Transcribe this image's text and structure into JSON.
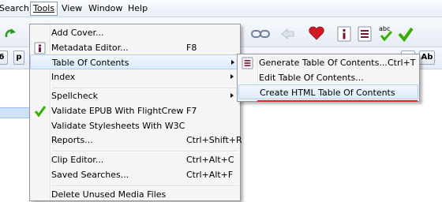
{
  "menubar": {
    "items": [
      {
        "label": "Search"
      },
      {
        "label": "Tools"
      },
      {
        "label": "View"
      },
      {
        "label": "Window"
      },
      {
        "label": "Help"
      }
    ]
  },
  "toolbar2": {
    "btn_6": "6",
    "btn_p": "p",
    "btn_ab": "Ab"
  },
  "tools_menu": {
    "items": [
      {
        "label": "Add Cover...",
        "shortcut": ""
      },
      {
        "label": "Metadata Editor...",
        "shortcut": "F8"
      },
      {
        "label": "Table Of Contents",
        "shortcut": ""
      },
      {
        "label": "Index",
        "shortcut": ""
      },
      {
        "label": "Spellcheck",
        "shortcut": ""
      },
      {
        "label": "Validate EPUB With FlightCrew",
        "shortcut": "F7"
      },
      {
        "label": "Validate Stylesheets With W3C",
        "shortcut": ""
      },
      {
        "label": "Reports...",
        "shortcut": "Ctrl+Shift+R"
      },
      {
        "label": "Clip Editor...",
        "shortcut": "Ctrl+Alt+C"
      },
      {
        "label": "Saved Searches...",
        "shortcut": "Ctrl+Alt+F"
      },
      {
        "label": "Delete Unused Media Files",
        "shortcut": ""
      }
    ]
  },
  "toc_submenu": {
    "items": [
      {
        "label": "Generate Table Of Contents...",
        "shortcut": "Ctrl+T"
      },
      {
        "label": "Edit Table Of Contents...",
        "shortcut": ""
      },
      {
        "label": "Create HTML Table Of Contents",
        "shortcut": ""
      }
    ]
  },
  "icons": {
    "redo": "redo-arrow-icon",
    "link": "link-icon",
    "back": "back-arrow-icon",
    "heart": "heart-icon",
    "metadata": "metadata-info-icon",
    "toc": "toc-list-icon",
    "spellcheck": "spellcheck-abc-icon",
    "validate": "green-check-icon"
  },
  "colors": {
    "highlight_bg": "#dcebfc",
    "highlight_border": "#aecff7",
    "annotation": "#e0262a",
    "check": "#36b000"
  }
}
